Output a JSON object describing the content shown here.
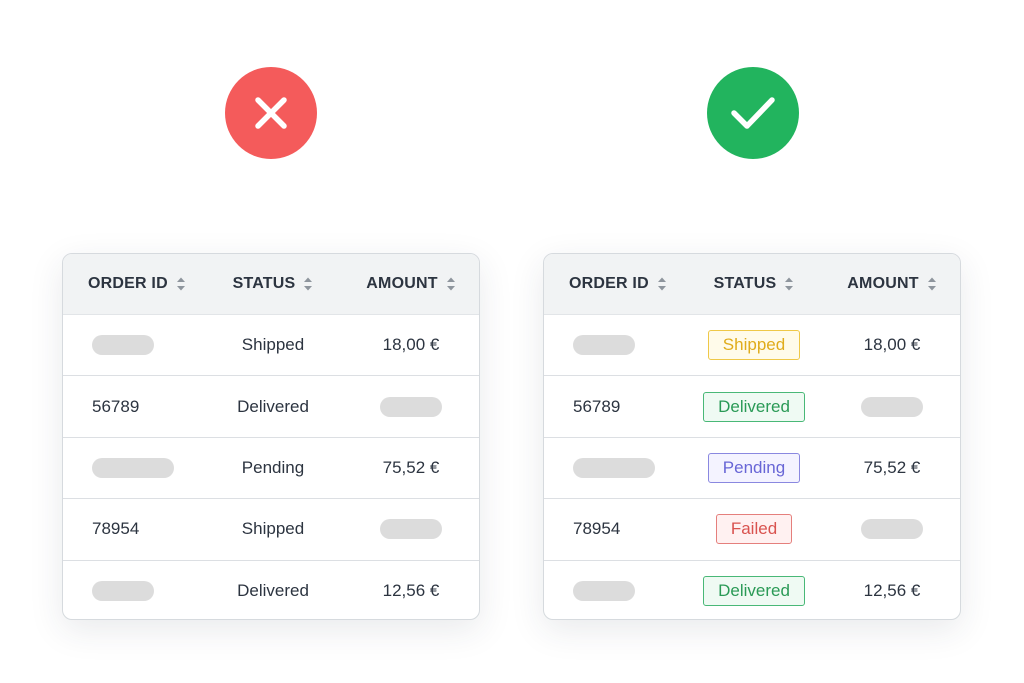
{
  "colors": {
    "bad_indicator": "#f45b5b",
    "good_indicator": "#22b45e"
  },
  "indicators": {
    "bad_icon": "close-icon",
    "good_icon": "check-icon"
  },
  "headers": {
    "order_id": "ORDER ID",
    "status": "STATUS",
    "amount": "AMOUNT"
  },
  "left_table": {
    "rows": [
      {
        "order_id": "",
        "order_id_placeholder": "short",
        "status": "Shipped",
        "amount": "18,00 €",
        "amount_placeholder": ""
      },
      {
        "order_id": "56789",
        "order_id_placeholder": "",
        "status": "Delivered",
        "amount": "",
        "amount_placeholder": "short"
      },
      {
        "order_id": "",
        "order_id_placeholder": "long",
        "status": "Pending",
        "amount": "75,52 €",
        "amount_placeholder": ""
      },
      {
        "order_id": "78954",
        "order_id_placeholder": "",
        "status": "Shipped",
        "amount": "",
        "amount_placeholder": "short"
      },
      {
        "order_id": "",
        "order_id_placeholder": "short",
        "status": "Delivered",
        "amount": "12,56 €",
        "amount_placeholder": ""
      }
    ]
  },
  "right_table": {
    "rows": [
      {
        "order_id": "",
        "order_id_placeholder": "short",
        "status": "Shipped",
        "amount": "18,00 €",
        "amount_placeholder": ""
      },
      {
        "order_id": "56789",
        "order_id_placeholder": "",
        "status": "Delivered",
        "amount": "",
        "amount_placeholder": "short"
      },
      {
        "order_id": "",
        "order_id_placeholder": "long",
        "status": "Pending",
        "amount": "75,52 €",
        "amount_placeholder": ""
      },
      {
        "order_id": "78954",
        "order_id_placeholder": "",
        "status": "Failed",
        "amount": "",
        "amount_placeholder": "short"
      },
      {
        "order_id": "",
        "order_id_placeholder": "short",
        "status": "Delivered",
        "amount": "12,56 €",
        "amount_placeholder": ""
      }
    ],
    "status_colors": {
      "Shipped": {
        "text": "#e0ac1c",
        "border": "#efc848",
        "bg": "#fffbea"
      },
      "Delivered": {
        "text": "#2a9a56",
        "border": "#49b877",
        "bg": "#effaf3"
      },
      "Pending": {
        "text": "#6866d6",
        "border": "#8a88e0",
        "bg": "#f4f3ff"
      },
      "Failed": {
        "text": "#d9534f",
        "border": "#e57f7c",
        "bg": "#fff1f1"
      }
    }
  }
}
